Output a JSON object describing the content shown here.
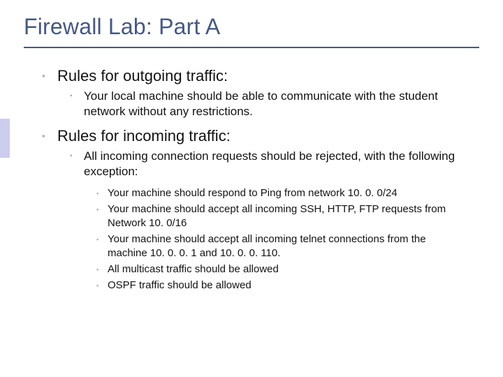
{
  "title": "Firewall Lab: Part A",
  "sections": [
    {
      "heading": "Rules for outgoing traffic:",
      "items": [
        {
          "text": "Your local machine should be able to communicate with the student network without any restrictions.",
          "subitems": []
        }
      ]
    },
    {
      "heading": "Rules for incoming traffic:",
      "items": [
        {
          "text": "All incoming connection requests should be rejected, with the following exception:",
          "subitems": [
            "Your machine should respond to Ping from network 10. 0. 0/24",
            "Your machine should accept all incoming SSH, HTTP, FTP requests from Network 10. 0/16",
            "Your machine should accept all incoming telnet connections from the machine 10. 0. 0. 1 and 10. 0. 0. 110.",
            "All multicast traffic should be allowed",
            "OSPF traffic should be allowed"
          ]
        }
      ]
    }
  ],
  "bullet_glyph": "▪"
}
